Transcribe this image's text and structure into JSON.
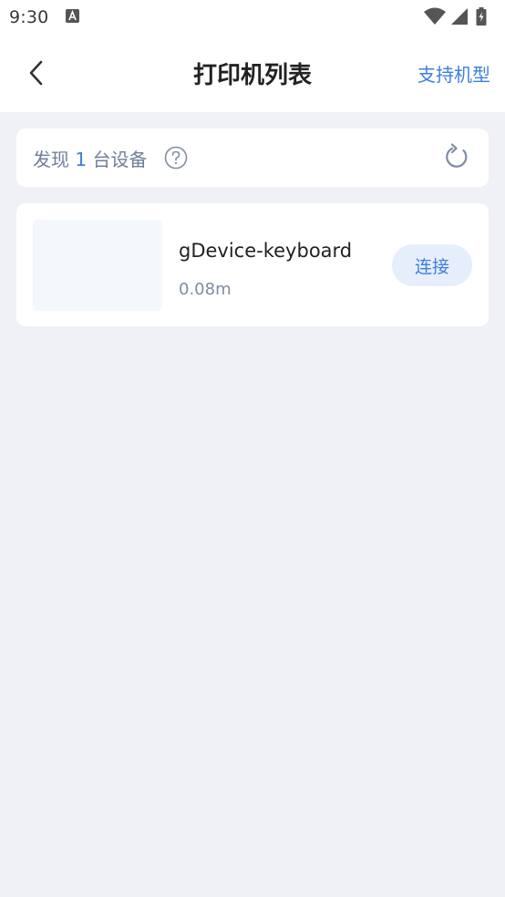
{
  "status_bar": {
    "time": "9:30"
  },
  "header": {
    "title": "打印机列表",
    "support_link": "支持机型"
  },
  "discover": {
    "prefix": "发现",
    "count": "1",
    "suffix": "台设备"
  },
  "devices": [
    {
      "name": "gDevice-keyboard",
      "distance": "0.08m",
      "connect_label": "连接"
    }
  ],
  "colors": {
    "accent": "#3d7fe0",
    "background": "#eff1f7",
    "card": "#ffffff",
    "muted_text": "#6f7f99"
  },
  "icons": {
    "back": "chevron-left-icon",
    "help": "question-circle-icon",
    "refresh": "refresh-icon",
    "wifi": "wifi-icon",
    "signal": "signal-icon",
    "battery": "battery-icon"
  }
}
